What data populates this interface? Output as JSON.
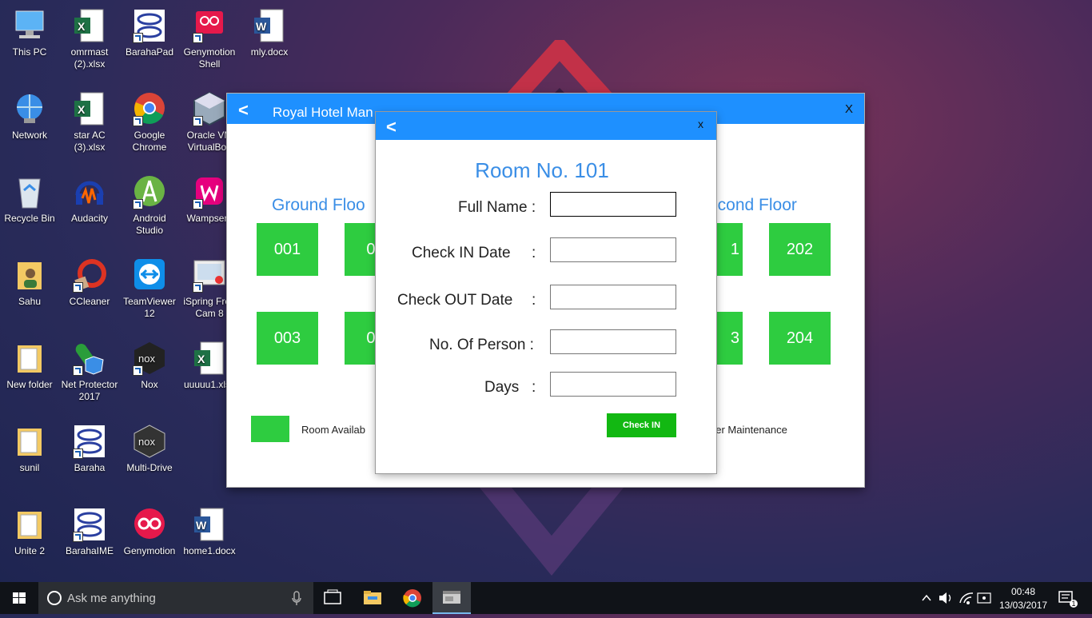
{
  "desktop_icons": [
    {
      "label": "This PC"
    },
    {
      "label": "omrmast (2).xlsx"
    },
    {
      "label": "BarahaPad"
    },
    {
      "label": "Genymotion Shell"
    },
    {
      "label": "mly.docx"
    },
    {
      "label": "Network"
    },
    {
      "label": "star AC (3).xlsx"
    },
    {
      "label": "Google Chrome"
    },
    {
      "label": "Oracle VM VirtualBox"
    },
    {
      "label": "Recycle Bin"
    },
    {
      "label": "Audacity"
    },
    {
      "label": "Android Studio"
    },
    {
      "label": "Wampserv"
    },
    {
      "label": "Sahu"
    },
    {
      "label": "CCleaner"
    },
    {
      "label": "TeamViewer 12"
    },
    {
      "label": "iSpring Free Cam 8"
    },
    {
      "label": "New folder"
    },
    {
      "label": "Net Protector 2017"
    },
    {
      "label": "Nox"
    },
    {
      "label": "uuuuu1.xlsx"
    },
    {
      "label": "sunil"
    },
    {
      "label": "Baraha"
    },
    {
      "label": "Multi-Drive"
    },
    {
      "label": "Unite 2"
    },
    {
      "label": "BarahaIME"
    },
    {
      "label": "Genymotion"
    },
    {
      "label": "home1.docx"
    }
  ],
  "main_window": {
    "back_icon": "<",
    "title": "Royal Hotel Man",
    "close_label": "X",
    "ground_floor_label": "Ground Floo",
    "second_floor_label": "econd Floor",
    "rooms": {
      "r001": "001",
      "r002": "00",
      "r003": "003",
      "r004": "00",
      "r201": "1",
      "r202": "202",
      "r203": "3",
      "r204": "204"
    },
    "legend_available": "Room Availab",
    "legend_maintenance": "der Maintenance"
  },
  "dialog": {
    "back_icon": "<",
    "close_label": "x",
    "title": "Room No. 101",
    "fields": {
      "full_name": {
        "label": "Full Name :",
        "value": ""
      },
      "check_in": {
        "label": "Check IN Date",
        "colon": ":",
        "value": ""
      },
      "check_out": {
        "label": "Check OUT Date",
        "colon": ":",
        "value": ""
      },
      "persons": {
        "label": "No. Of Person :",
        "value": ""
      },
      "days": {
        "label": "Days",
        "colon": ":",
        "value": ""
      }
    },
    "submit_label": "Check IN"
  },
  "taskbar": {
    "search_placeholder": "Ask me anything",
    "time": "00:48",
    "date": "13/03/2017",
    "notification_count": "1"
  },
  "colors": {
    "accent": "#1e90ff",
    "room_available": "#2ecc40",
    "submit": "#12b812"
  }
}
